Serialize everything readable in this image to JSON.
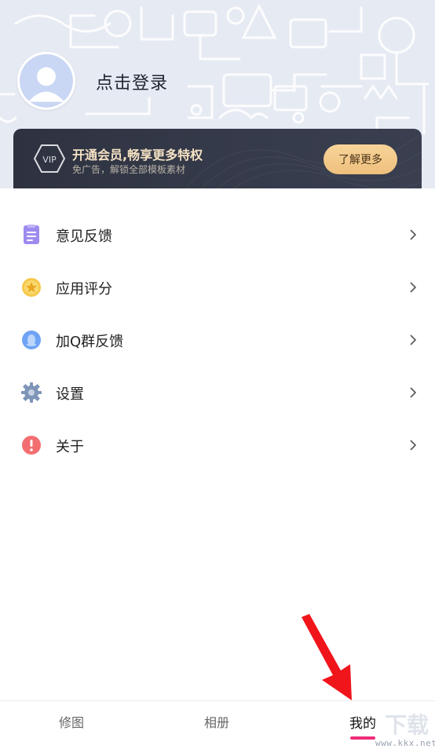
{
  "profile": {
    "login_label": "点击登录"
  },
  "vip": {
    "badge_text": "VIP",
    "title": "开通会员,畅享更多特权",
    "subtitle": "免广告，解锁全部模板素材",
    "button_label": "了解更多"
  },
  "menu": {
    "items": [
      {
        "label": "意见反馈",
        "icon": "feedback-icon"
      },
      {
        "label": "应用评分",
        "icon": "star-icon"
      },
      {
        "label": "加Q群反馈",
        "icon": "qq-icon"
      },
      {
        "label": "设置",
        "icon": "gear-icon"
      },
      {
        "label": "关于",
        "icon": "info-icon"
      }
    ]
  },
  "tabbar": {
    "tabs": [
      {
        "label": "修图"
      },
      {
        "label": "相册"
      },
      {
        "label": "我的"
      }
    ],
    "active_index": 2
  },
  "watermark": {
    "chars": "下载",
    "url": "www.kkx.net"
  },
  "colors": {
    "accent": "#ee2d7a",
    "vip_button": "#f2c98a",
    "header_bg": "#e6eaf3"
  }
}
